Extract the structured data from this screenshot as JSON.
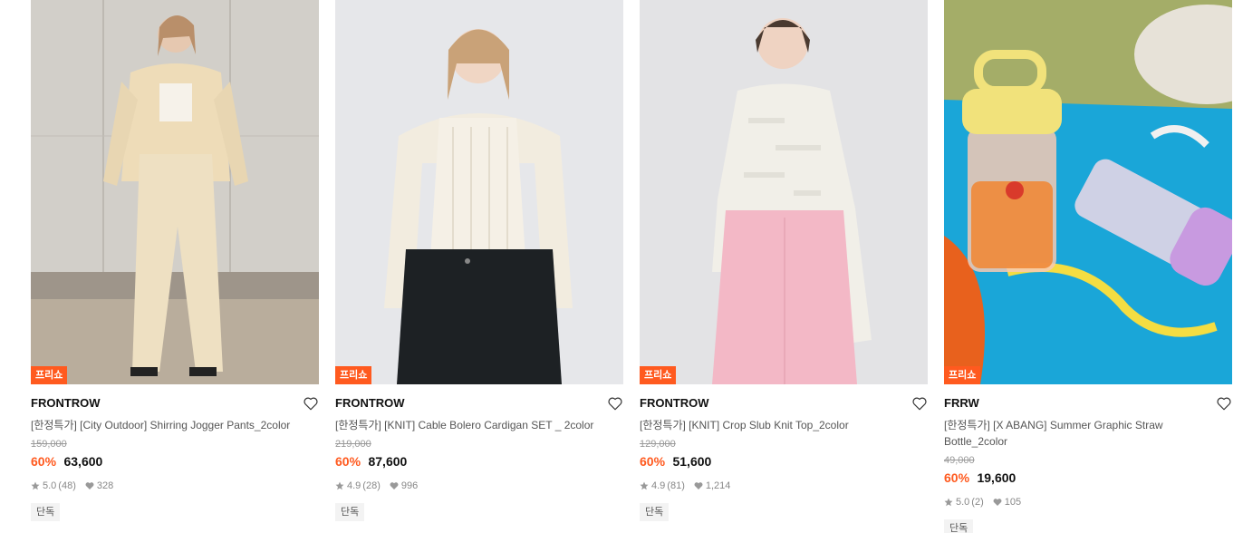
{
  "products": [
    {
      "badge": "프리쇼",
      "brand": "FRONTROW",
      "name": "[한정특가] [City Outdoor] Shirring Jogger Pants_2color",
      "original_price": "159,000",
      "discount": "60%",
      "price": "63,600",
      "rating": "5.0",
      "reviews": "(48)",
      "likes": "328",
      "tag": "단독",
      "image_icon": "photo-model-jogger-pants"
    },
    {
      "badge": "프리쇼",
      "brand": "FRONTROW",
      "name": "[한정특가] [KNIT] Cable Bolero Cardigan SET _ 2color",
      "original_price": "219,000",
      "discount": "60%",
      "price": "87,600",
      "rating": "4.9",
      "reviews": "(28)",
      "likes": "996",
      "tag": "단독",
      "image_icon": "photo-model-knit-set"
    },
    {
      "badge": "프리쇼",
      "brand": "FRONTROW",
      "name": "[한정특가] [KNIT] Crop Slub Knit Top_2color",
      "original_price": "129,000",
      "discount": "60%",
      "price": "51,600",
      "rating": "4.9",
      "reviews": "(81)",
      "likes": "1,214",
      "tag": "단독",
      "image_icon": "photo-model-knit-top"
    },
    {
      "badge": "프리쇼",
      "brand": "FRRW",
      "name": "[한정특가] [X ABANG] Summer Graphic Straw Bottle_2color",
      "original_price": "49,000",
      "discount": "60%",
      "price": "19,600",
      "rating": "5.0",
      "reviews": "(2)",
      "likes": "105",
      "tag": "단독",
      "image_icon": "photo-straw-bottles"
    }
  ],
  "colors": {
    "accent": "#ff5a1f",
    "text": "#111111",
    "muted": "#999999"
  }
}
